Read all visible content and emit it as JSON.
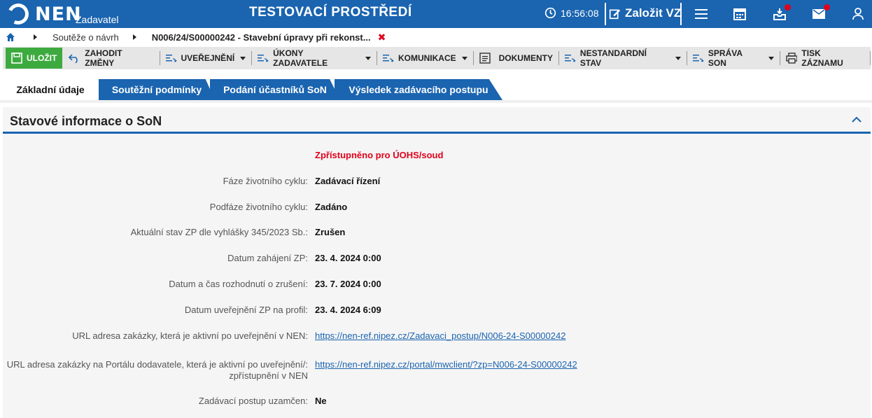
{
  "header": {
    "logo_text": "NEN",
    "logo_sub": "Zadavatel",
    "env_title": "TESTOVACÍ PROSTŘEDÍ",
    "time": "16:56:08",
    "create_label": "Založit VZ",
    "icons": [
      "clock-icon",
      "edit-icon",
      "menu-icon",
      "calendar-icon",
      "inbox-icon",
      "mail-icon",
      "user-icon"
    ]
  },
  "breadcrumb": {
    "item1": "Soutěže o návrh",
    "item2": "N006/24/S00000242 - Stavební úpravy při rekonst..."
  },
  "toolbar": {
    "save": "ULOŽIT",
    "discard": "ZAHODIT ZMĚNY",
    "publish": "UVEŘEJNĚNÍ",
    "actions": "ÚKONY ZADAVATELE",
    "communication": "KOMUNIKACE",
    "documents": "DOKUMENTY",
    "nonstandard": "NESTANDARDNÍ STAV",
    "manage": "SPRÁVA SON",
    "print": "TISK ZÁZNAMU"
  },
  "tabs": [
    {
      "label": "Základní údaje"
    },
    {
      "label": "Soutěžní podmínky"
    },
    {
      "label": "Podání účastníků SoN"
    },
    {
      "label": "Výsledek zadávacího postupu"
    }
  ],
  "section": {
    "title": "Stavové informace o SoN",
    "status": "Zpřístupněno pro ÚOHS/soud",
    "rows": [
      {
        "label": "Fáze životního cyklu:",
        "value": "Zadávací řízení"
      },
      {
        "label": "Podfáze životního cyklu:",
        "value": "Zadáno"
      },
      {
        "label": "Aktuální stav ZP dle vyhlášky 345/2023 Sb.:",
        "value": "Zrušen"
      },
      {
        "label": "Datum zahájení ZP:",
        "value": "23. 4. 2024 0:00"
      },
      {
        "label": "Datum a čas rozhodnutí o zrušení:",
        "value": "23. 7. 2024 0:00"
      },
      {
        "label": "Datum uveřejnění ZP na profil:",
        "value": "23. 4. 2024 6:09"
      },
      {
        "label": "URL adresa zakázky, která je aktivní po uveřejnění v NEN:",
        "value": "https://nen-ref.nipez.cz/Zadavaci_postup/N006-24-S00000242"
      },
      {
        "label": "URL adresa zakázky na Portálu dodavatele, která je aktivní po uveřejnění/: zpřístupnění v NEN",
        "value": "https://nen-ref.nipez.cz/portal/mwclient/?zp=N006-24-S00000242"
      },
      {
        "label": "Zadávací postup uzamčen:",
        "value": "Ne"
      }
    ]
  }
}
